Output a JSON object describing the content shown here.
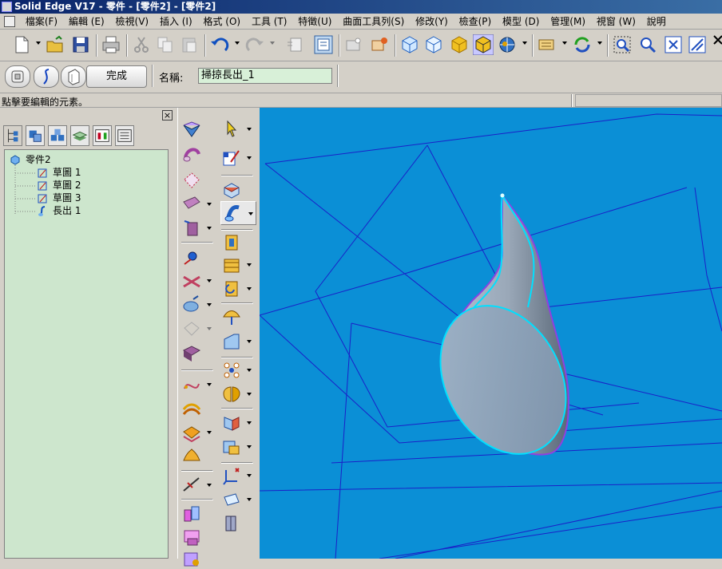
{
  "window": {
    "title": "Solid Edge V17 - 零件 - [零件2] - [零件2]"
  },
  "menu": {
    "items": [
      "檔案(F)",
      "編輯 (E)",
      "檢視(V)",
      "插入 (I)",
      "格式 (O)",
      "工具 (T)",
      "特徵(U)",
      "曲面工具列(S)",
      "修改(Y)",
      "檢查(P)",
      "模型 (D)",
      "管理(M)",
      "視窗 (W)",
      "說明"
    ]
  },
  "toolbar": {
    "icons": [
      "new-icon",
      "open-icon",
      "save-icon",
      "print-icon",
      "cut-icon",
      "copy-icon",
      "paste-icon",
      "undo-icon",
      "redo-icon",
      "properties-icon",
      "view-icon",
      "constraint-icon",
      "sketch-icon",
      "iso-view-icon",
      "dimetric-view-icon",
      "shaded-icon",
      "shaded-edges-icon",
      "orient-icon",
      "layer-icon",
      "rotate-icon",
      "zoom-area-icon",
      "zoom-icon",
      "fit-icon",
      "pan-icon"
    ]
  },
  "ribbon": {
    "done_label": "完成",
    "name_label": "名稱:",
    "name_value": "掃掠長出_1"
  },
  "status": {
    "prompt": "點擊要編輯的元素。"
  },
  "edgebar": {
    "close_label": "×",
    "tree": [
      {
        "label": "零件2",
        "icon": "part-icon"
      },
      {
        "label": "草圖 1",
        "icon": "sketch-icon"
      },
      {
        "label": "草圖 2",
        "icon": "sketch-icon"
      },
      {
        "label": "草圖 3",
        "icon": "sketch-icon"
      },
      {
        "label": "長出 1",
        "icon": "protrusion-icon"
      }
    ]
  },
  "colors": {
    "viewport_bg": "#0b8fd6",
    "tree_bg": "#cde6cd",
    "title_bg": "#0a246a",
    "highlight": "#00e0ff"
  }
}
